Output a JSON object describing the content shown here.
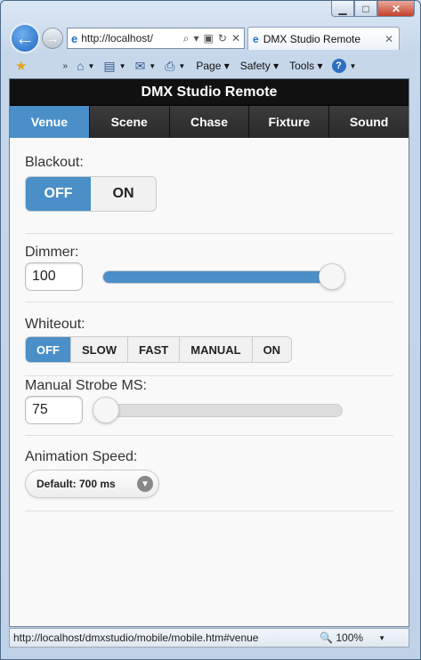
{
  "window": {
    "min_label": "▁",
    "max_label": "□",
    "close_label": "✕"
  },
  "browser": {
    "address": "http://localhost/",
    "tab_title": "DMX Studio Remote",
    "menus": [
      "Page",
      "Safety",
      "Tools"
    ],
    "chevron": "»"
  },
  "app": {
    "title": "DMX Studio Remote",
    "nav": [
      "Venue",
      "Scene",
      "Chase",
      "Fixture",
      "Sound"
    ],
    "active_nav": "Venue"
  },
  "blackout": {
    "label": "Blackout:",
    "options": [
      "OFF",
      "ON"
    ],
    "selected": "OFF"
  },
  "dimmer": {
    "label": "Dimmer:",
    "value": "100",
    "slider_fraction": 1.0
  },
  "whiteout": {
    "label": "Whiteout:",
    "options": [
      "OFF",
      "SLOW",
      "FAST",
      "MANUAL",
      "ON"
    ],
    "selected": "OFF"
  },
  "strobe": {
    "label": "Manual Strobe MS:",
    "value": "75",
    "slider_fraction": 0.0
  },
  "animation": {
    "label": "Animation Speed:",
    "selected": "Default: 700 ms"
  },
  "status": {
    "url": "http://localhost/dmxstudio/mobile/mobile.htm#venue",
    "zoom": "100%"
  },
  "colors": {
    "accent": "#4a8fc7",
    "header_bg": "#111111",
    "nav_bg": "#333333"
  }
}
